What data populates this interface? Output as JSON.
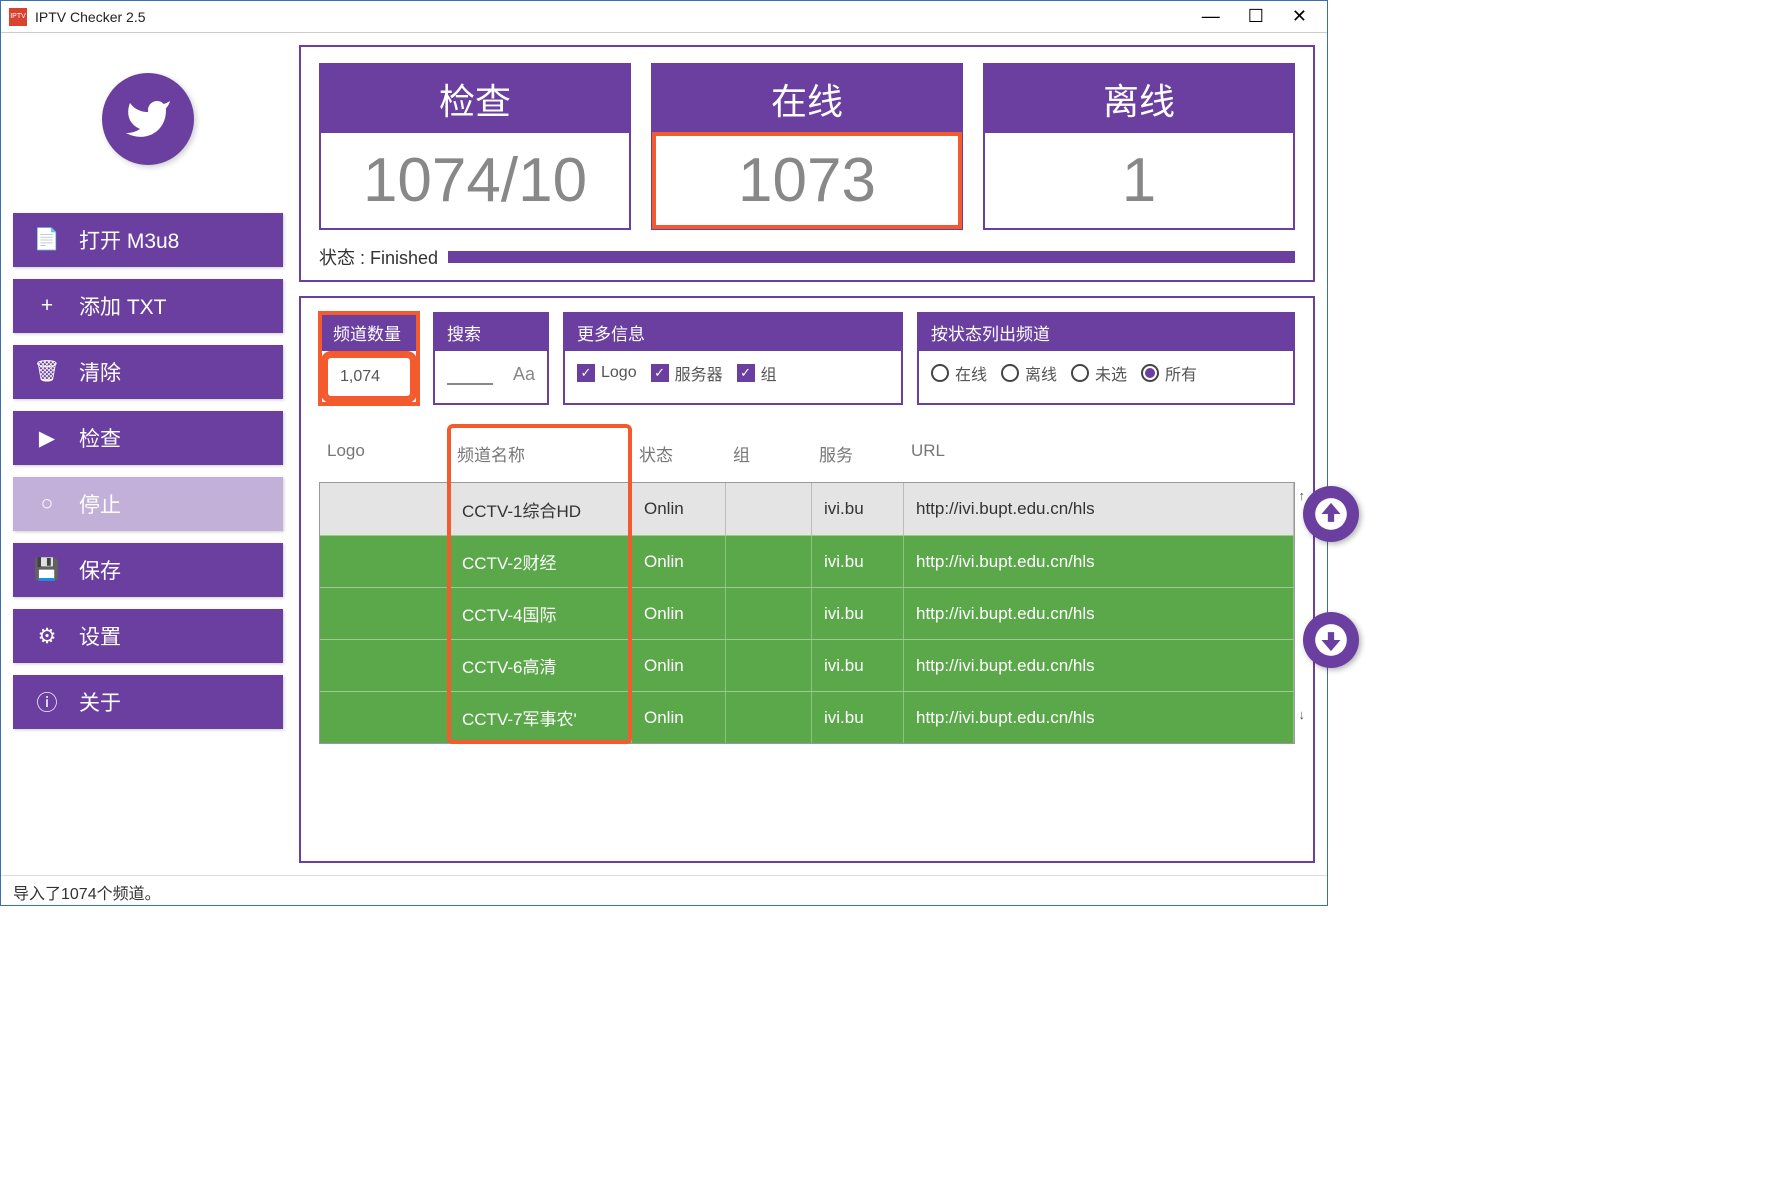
{
  "window": {
    "title": "IPTV Checker 2.5"
  },
  "sidebar": {
    "open_label": "打开 M3u8",
    "add_txt_label": "添加 TXT",
    "clear_label": "清除",
    "check_label": "检查",
    "stop_label": "停止",
    "save_label": "保存",
    "settings_label": "设置",
    "about_label": "关于"
  },
  "stats": {
    "checked_label": "检查",
    "checked_value": "1074/10",
    "online_label": "在线",
    "online_value": "1073",
    "offline_label": "离线",
    "offline_value": "1"
  },
  "status": {
    "label": "状态 : Finished"
  },
  "filters": {
    "count_label": "频道数量",
    "count_value": "1,074",
    "search_label": "搜索",
    "search_placeholder": "Aa",
    "more_label": "更多信息",
    "logo_cb": "Logo",
    "server_cb": "服务器",
    "group_cb": "组",
    "bystate_label": "按状态列出频道",
    "radio_online": "在线",
    "radio_offline": "离线",
    "radio_unselected": "未选",
    "radio_all": "所有"
  },
  "table": {
    "headers": {
      "logo": "Logo",
      "name": "频道名称",
      "status": "状态",
      "group": "组",
      "server": "服务",
      "url": "URL"
    },
    "rows": [
      {
        "name": "CCTV-1综合HD",
        "status": "Onlin",
        "group": "",
        "server": "ivi.bu",
        "url": "http://ivi.bupt.edu.cn/hls"
      },
      {
        "name": "CCTV-2财经",
        "status": "Onlin",
        "group": "",
        "server": "ivi.bu",
        "url": "http://ivi.bupt.edu.cn/hls"
      },
      {
        "name": "CCTV-4国际",
        "status": "Onlin",
        "group": "",
        "server": "ivi.bu",
        "url": "http://ivi.bupt.edu.cn/hls"
      },
      {
        "name": "CCTV-6高清",
        "status": "Onlin",
        "group": "",
        "server": "ivi.bu",
        "url": "http://ivi.bupt.edu.cn/hls"
      },
      {
        "name": "CCTV-7军事农'",
        "status": "Onlin",
        "group": "",
        "server": "ivi.bu",
        "url": "http://ivi.bupt.edu.cn/hls"
      }
    ]
  },
  "statusbar": {
    "text": "导入了1074个频道。"
  }
}
